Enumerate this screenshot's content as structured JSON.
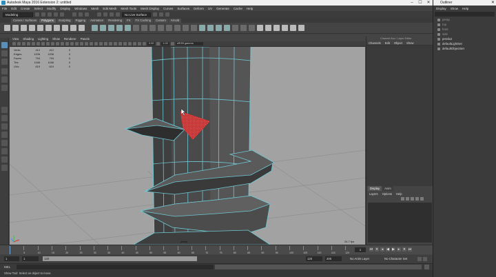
{
  "window": {
    "title": "Autodesk Maya 2016 Extension 2: untitled",
    "minimize": "–",
    "maximize": "☐",
    "close": "✕"
  },
  "menu": [
    "File",
    "Edit",
    "Create",
    "Select",
    "Modify",
    "Display",
    "Windows",
    "Mesh",
    "Edit Mesh",
    "Mesh Tools",
    "Mesh Display",
    "Curves",
    "Surfaces",
    "Deform",
    "UV",
    "Generate",
    "Cache",
    "Help"
  ],
  "status_line": {
    "workspace": "Modeling",
    "live_surface": "No Live Surface"
  },
  "shelf_tabs": [
    {
      "label": "Curves / Surfaces",
      "active": false
    },
    {
      "label": "Polygons",
      "active": true
    },
    {
      "label": "Sculpting",
      "active": false
    },
    {
      "label": "Rigging",
      "active": false
    },
    {
      "label": "Animation",
      "active": false
    },
    {
      "label": "Rendering",
      "active": false
    },
    {
      "label": "FX",
      "active": false
    },
    {
      "label": "FX Caching",
      "active": false
    },
    {
      "label": "Custom",
      "active": false
    },
    {
      "label": "Arnold",
      "active": false
    }
  ],
  "panel_menu": [
    "View",
    "Shading",
    "Lighting",
    "Show",
    "Renderer",
    "Panels"
  ],
  "panel_toolbar": {
    "exposure": "0.00",
    "gamma": "1.00",
    "color_space": "sRGB gamma"
  },
  "hud": {
    "rows": [
      {
        "label": "Verts:",
        "a": "412",
        "b": "412",
        "c": "0"
      },
      {
        "label": "Edges:",
        "a": "1206",
        "b": "1206",
        "c": "0"
      },
      {
        "label": "Faces:",
        "a": "794",
        "b": "794",
        "c": "0"
      },
      {
        "label": "Tris:",
        "a": "1166",
        "b": "1166",
        "c": "0"
      },
      {
        "label": "UVs:",
        "a": "619",
        "b": "619",
        "c": "0"
      }
    ],
    "camera": "persp",
    "fps": "24.7 fps"
  },
  "channel_box": {
    "title": "Channel Box / Layer Editor",
    "menu": [
      "Channels",
      "Edit",
      "Object",
      "Show"
    ]
  },
  "layer_editor": {
    "tabs": [
      {
        "label": "Display",
        "active": true
      },
      {
        "label": "Anim",
        "active": false
      }
    ],
    "menu": [
      "Layers",
      "Options",
      "Help"
    ]
  },
  "time_slider": {
    "ticks": [
      "5",
      "10",
      "15",
      "20",
      "25",
      "30",
      "35",
      "40",
      "45",
      "50",
      "55",
      "60",
      "65",
      "70",
      "75",
      "80",
      "85",
      "90",
      "95",
      "100",
      "105",
      "110",
      "115",
      "120"
    ],
    "current_frame": "1"
  },
  "range": {
    "start": "1",
    "playback_start": "1",
    "range_label": "120",
    "playback_end": "120",
    "end": "200",
    "anim_layer": "No Anim Layer",
    "char_set": "No Character Set"
  },
  "mel": {
    "label": "MEL"
  },
  "help_line": "Show Tool: Select an object to move.",
  "outliner": {
    "title": "Outliner",
    "menu": [
      "Display",
      "Show",
      "Help"
    ],
    "items": [
      {
        "label": "persp",
        "visible": false
      },
      {
        "label": "top",
        "visible": false
      },
      {
        "label": "front",
        "visible": false
      },
      {
        "label": "side",
        "visible": false
      },
      {
        "label": "pHelix2",
        "visible": true
      },
      {
        "label": "defaultLightSet",
        "visible": true
      },
      {
        "label": "defaultObjectSet",
        "visible": true
      }
    ]
  },
  "colors": {
    "viewport_bg": "#a2a2a2",
    "mesh_dark": "#3d3d3d",
    "mesh_mid": "#545454",
    "wire": "#6fc9d6",
    "face_selected": "#d63a3a",
    "active_tool": "#5b8fb5"
  }
}
